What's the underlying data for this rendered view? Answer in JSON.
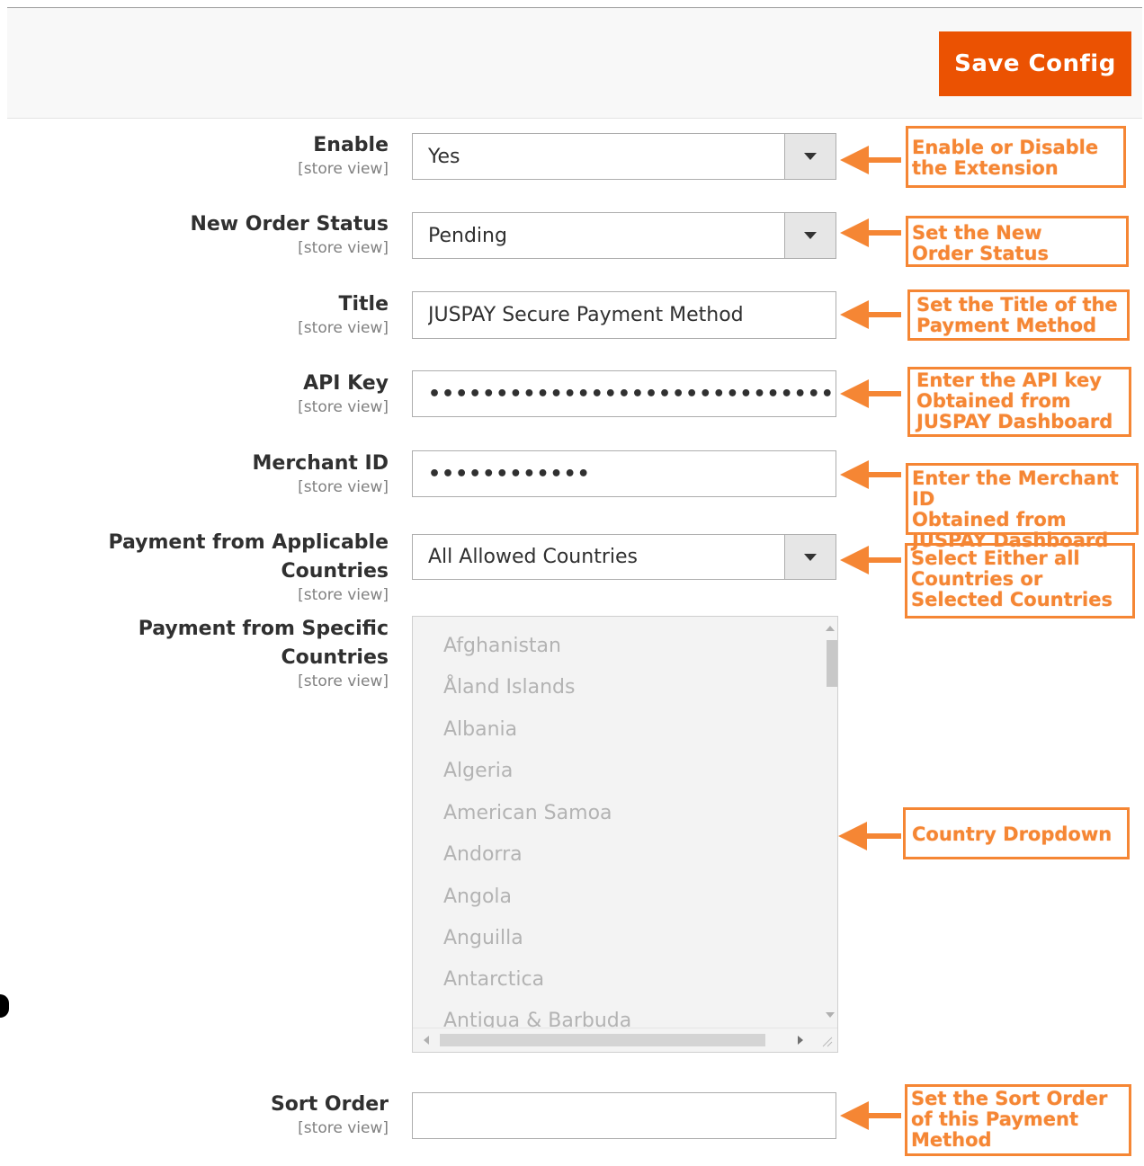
{
  "toolbar": {
    "save_label": "Save Config"
  },
  "fields": {
    "enable": {
      "label": "Enable",
      "scope": "[store view]",
      "value": "Yes"
    },
    "order_status": {
      "label": "New Order Status",
      "scope": "[store view]",
      "value": "Pending"
    },
    "title": {
      "label": "Title",
      "scope": "[store view]",
      "value": "JUSPAY Secure Payment Method"
    },
    "api_key": {
      "label": "API Key",
      "scope": "[store view]",
      "value": "••••••••••••••••••••••••••••••••"
    },
    "merchant_id": {
      "label": "Merchant ID",
      "scope": "[store view]",
      "value": "••••••••••••"
    },
    "applicable": {
      "label_line1": "Payment from Applicable",
      "label_line2": "Countries",
      "scope": "[store view]",
      "value": "All Allowed Countries"
    },
    "specific": {
      "label_line1": "Payment from Specific",
      "label_line2": "Countries",
      "scope": "[store view]",
      "countries": [
        "Afghanistan",
        "Åland Islands",
        "Albania",
        "Algeria",
        "American Samoa",
        "Andorra",
        "Angola",
        "Anguilla",
        "Antarctica",
        "Antigua & Barbuda"
      ]
    },
    "sort_order": {
      "label": "Sort Order",
      "scope": "[store view]",
      "value": ""
    }
  },
  "callouts": {
    "enable": [
      "Enable or Disable",
      "the Extension"
    ],
    "order_status": [
      "Set the New",
      "Order Status"
    ],
    "title": [
      "Set the Title of the",
      "Payment Method"
    ],
    "api_key": [
      "Enter the API key",
      "Obtained from",
      "JUSPAY Dashboard"
    ],
    "merchant_id": [
      "Enter the Merchant ID",
      "Obtained from",
      "JUSPAY Dashboard"
    ],
    "applicable": [
      "Select Either all",
      "Countries or",
      "Selected Countries"
    ],
    "specific": [
      "Country Dropdown"
    ],
    "sort_order": [
      "Set the Sort Order",
      "of this Payment",
      "Method"
    ]
  },
  "colors": {
    "accent": "#eb5202",
    "annotation": "#f58634"
  },
  "icons": {
    "select_arrow": "triangle-down-icon",
    "annotation_arrow": "arrow-left-icon"
  }
}
